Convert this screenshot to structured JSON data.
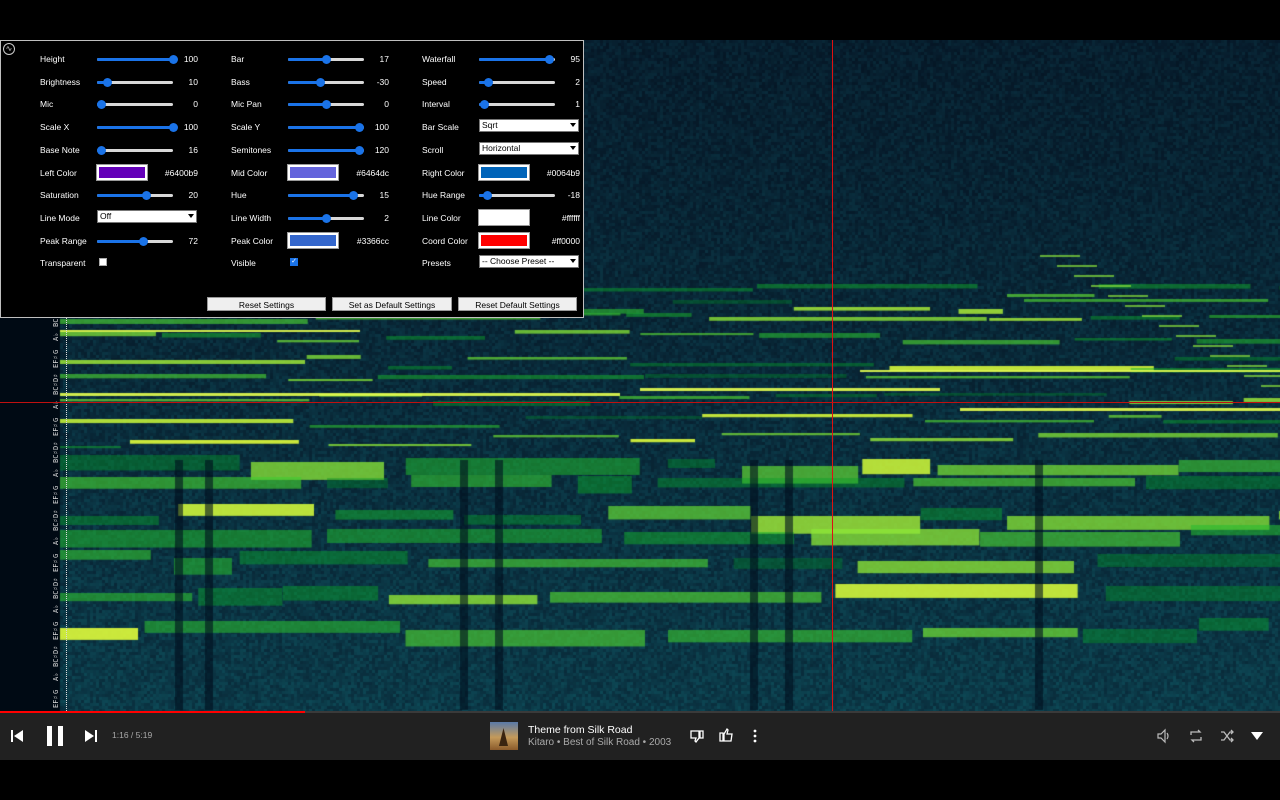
{
  "settings": {
    "col1": [
      {
        "label": "Height",
        "type": "slider",
        "value": "100",
        "fraction": 1.0
      },
      {
        "label": "Brightness",
        "type": "slider",
        "value": "10",
        "fraction": 0.13
      },
      {
        "label": "Mic",
        "type": "slider",
        "value": "0",
        "fraction": 0.05
      },
      {
        "label": "Scale X",
        "type": "slider",
        "value": "100",
        "fraction": 1.0
      },
      {
        "label": "Base Note",
        "type": "slider",
        "value": "16",
        "fraction": 0.05
      },
      {
        "label": "Left Color",
        "type": "color",
        "value": "#6400b9",
        "color": "#6400b9"
      },
      {
        "label": "Saturation",
        "type": "slider",
        "value": "20",
        "fraction": 0.64
      },
      {
        "label": "Line Mode",
        "type": "select",
        "value": "Off"
      },
      {
        "label": "Peak Range",
        "type": "slider",
        "value": "72",
        "fraction": 0.6
      },
      {
        "label": "Transparent",
        "type": "check",
        "checked": false
      }
    ],
    "col2": [
      {
        "label": "Bar",
        "type": "slider",
        "value": "17",
        "fraction": 0.5
      },
      {
        "label": "Bass",
        "type": "slider",
        "value": "-30",
        "fraction": 0.42
      },
      {
        "label": "Mic Pan",
        "type": "slider",
        "value": "0",
        "fraction": 0.5
      },
      {
        "label": "Scale Y",
        "type": "slider",
        "value": "100",
        "fraction": 0.93
      },
      {
        "label": "Semitones",
        "type": "slider",
        "value": "120",
        "fraction": 0.93
      },
      {
        "label": "Mid Color",
        "type": "color",
        "value": "#6464dc",
        "color": "#6464dc"
      },
      {
        "label": "Hue",
        "type": "slider",
        "value": "15",
        "fraction": 0.85
      },
      {
        "label": "Line Width",
        "type": "slider",
        "value": "2",
        "fraction": 0.5
      },
      {
        "label": "Peak Color",
        "type": "color",
        "value": "#3366cc",
        "color": "#3366cc"
      },
      {
        "label": "Visible",
        "type": "check",
        "checked": true
      }
    ],
    "col3": [
      {
        "label": "Waterfall",
        "type": "slider",
        "value": "95",
        "fraction": 0.92
      },
      {
        "label": "Speed",
        "type": "slider",
        "value": "2",
        "fraction": 0.12
      },
      {
        "label": "Interval",
        "type": "slider",
        "value": "1",
        "fraction": 0.06
      },
      {
        "label": "Bar Scale",
        "type": "select",
        "value": "Sqrt"
      },
      {
        "label": "Scroll",
        "type": "select",
        "value": "Horizontal"
      },
      {
        "label": "Right Color",
        "type": "color",
        "value": "#0064b9",
        "color": "#0064b9"
      },
      {
        "label": "Hue Range",
        "type": "slider",
        "value": "-18",
        "fraction": 0.1
      },
      {
        "label": "Line Color",
        "type": "color",
        "value": "#ffffff",
        "color": "#ffffff"
      },
      {
        "label": "Coord Color",
        "type": "color",
        "value": "#ff0000",
        "color": "#ff0000"
      },
      {
        "label": "Presets",
        "type": "select",
        "value": "-- Choose Preset --"
      }
    ],
    "buttons": [
      "Reset Settings",
      "Set as Default Settings",
      "Reset Default Settings"
    ]
  },
  "note_labels": [
    "EF♯",
    "G",
    "A♭",
    "BC♯",
    "D♯",
    "EF♯",
    "G",
    "A♭",
    "BC♯",
    "D♯",
    "EF♯",
    "G",
    "A♭",
    "BC♯",
    "D♯",
    "EF♯",
    "G",
    "A♭",
    "BC♯",
    "D♯",
    "EF♯",
    "G",
    "A♭",
    "BC♯",
    "D♯",
    "EF♯",
    "G",
    "A♭",
    "BC♯"
  ],
  "player": {
    "time": "1:16 / 5:19",
    "progress": 0.238,
    "track_title": "Theme from Silk Road",
    "track_subtitle": "Kitaro • Best of Silk Road • 2003"
  },
  "icons": {
    "prev": "skip-previous-icon",
    "pause": "pause-icon",
    "next": "skip-next-icon",
    "dislike": "thumb-down-icon",
    "like": "thumb-up-icon",
    "more": "more-vert-icon",
    "volume": "volume-icon",
    "repeat": "repeat-icon",
    "shuffle": "shuffle-icon",
    "expand": "expand-icon"
  },
  "colors": {
    "accent": "#1a73e8",
    "progress": "#ff0000",
    "coord": "#ff0000"
  }
}
